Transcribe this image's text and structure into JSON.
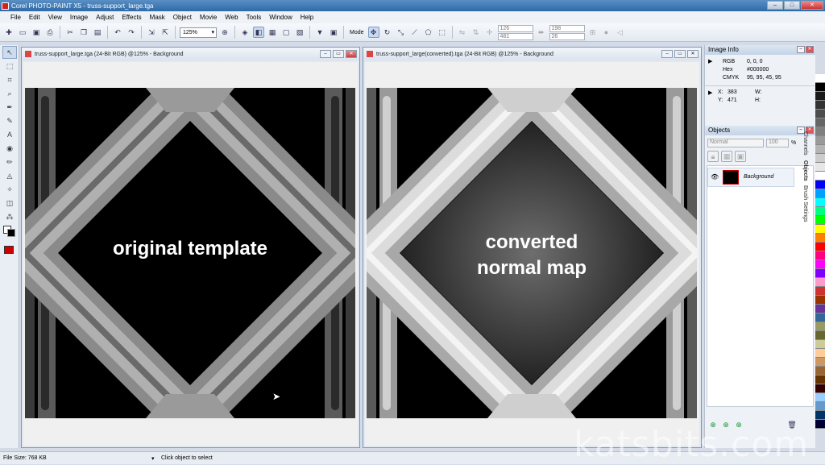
{
  "window": {
    "title": "Corel PHOTO-PAINT X5 - truss-support_large.tga"
  },
  "menu": [
    "File",
    "Edit",
    "View",
    "Image",
    "Adjust",
    "Effects",
    "Mask",
    "Object",
    "Movie",
    "Web",
    "Tools",
    "Window",
    "Help"
  ],
  "toolbar": {
    "zoom": "125%",
    "mode_label": "Mode",
    "x_value": "126",
    "y_value": "481",
    "w_value": "198",
    "h_value": "26"
  },
  "doc_left": {
    "title": "truss-support_large.tga (24-Bit RGB) @125% - Background",
    "overlay": "original template"
  },
  "doc_right": {
    "title": "truss-support_large(converted).tga (24-Bit RGB) @125% - Background",
    "overlay_line1": "converted",
    "overlay_line2": "normal map"
  },
  "image_info": {
    "title": "Image Info",
    "rgb_label": "RGB",
    "rgb": "0,  0,  0",
    "hex_label": "Hex",
    "hex": "#000000",
    "cmyk_label": "CMYK",
    "cmyk": "95, 95, 45, 95",
    "x_label": "X:",
    "x": "383",
    "y_label": "Y:",
    "y": "471",
    "w_label": "W:",
    "h_label": "H:"
  },
  "objects_panel": {
    "title": "Objects",
    "blend_mode": "Normal",
    "opacity": "100",
    "opacity_unit": "%",
    "layer_name": "Background"
  },
  "side_tabs": {
    "channels": "Channels",
    "objects": "Objects",
    "brush": "Brush Settings"
  },
  "status": {
    "file_size": "File Size: 768 KB",
    "hint": "Click object to select"
  },
  "watermark": "katsbits.com",
  "palette": [
    "#ffffff",
    "#000000",
    "#1a1a1a",
    "#333333",
    "#4d4d4d",
    "#666666",
    "#808080",
    "#999999",
    "#b3b3b3",
    "#cccccc",
    "#e6e6e6",
    "#ffffff",
    "#0000ff",
    "#00a0ff",
    "#00ffff",
    "#00ff80",
    "#00ff00",
    "#ffff00",
    "#ff8000",
    "#ff0000",
    "#ff0080",
    "#ff00ff",
    "#8000ff",
    "#ff99cc",
    "#cc3333",
    "#993300",
    "#663399",
    "#336699",
    "#999966",
    "#666633",
    "#cccc99",
    "#ffcc99",
    "#cc9966",
    "#996633",
    "#663300",
    "#330000",
    "#99ccff",
    "#6699cc",
    "#003366",
    "#000033"
  ]
}
